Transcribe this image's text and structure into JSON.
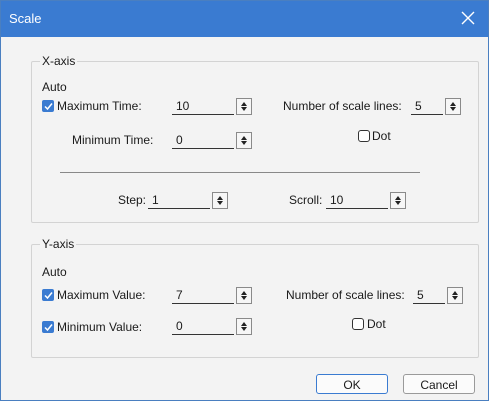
{
  "dialog": {
    "title": "Scale"
  },
  "x_axis": {
    "group_label": "X-axis",
    "auto_label": "Auto",
    "max_time": {
      "label": "Maximum Time:",
      "value": "10",
      "checked": true
    },
    "min_time": {
      "label": "Minimum Time:",
      "value": "0"
    },
    "scale_lines": {
      "label": "Number of scale lines:",
      "value": "5"
    },
    "dot": {
      "label": "Dot",
      "checked": false
    },
    "step": {
      "label": "Step:",
      "value": "1"
    },
    "scroll": {
      "label": "Scroll:",
      "value": "10"
    }
  },
  "y_axis": {
    "group_label": "Y-axis",
    "auto_label": "Auto",
    "max_value": {
      "label": "Maximum Value:",
      "value": "7",
      "checked": true
    },
    "min_value": {
      "label": "Minimum Value:",
      "value": "0",
      "checked": true
    },
    "scale_lines": {
      "label": "Number of scale lines:",
      "value": "5"
    },
    "dot": {
      "label": "Dot",
      "checked": false
    }
  },
  "buttons": {
    "ok": "OK",
    "cancel": "Cancel"
  },
  "colors": {
    "titlebar": "#3a7bd1",
    "checkbox": "#3a7bd1"
  },
  "icons": {
    "close": "close-icon",
    "check": "check-icon",
    "spin": "spin-up-down-icon"
  }
}
